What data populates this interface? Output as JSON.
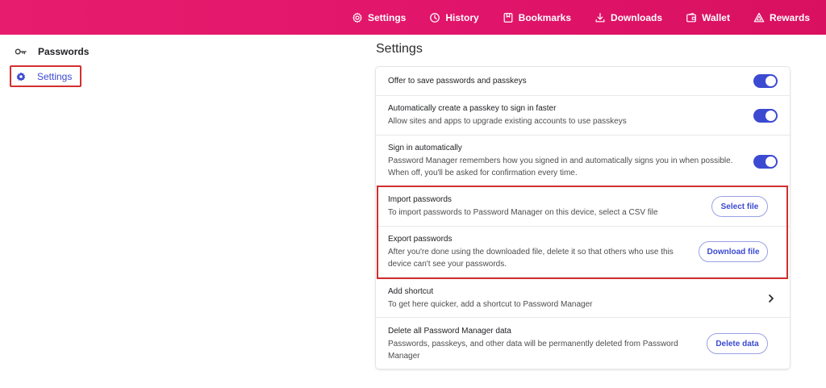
{
  "topnav": {
    "items": [
      {
        "label": "Settings",
        "icon": "gear-icon"
      },
      {
        "label": "History",
        "icon": "history-icon"
      },
      {
        "label": "Bookmarks",
        "icon": "bookmark-icon"
      },
      {
        "label": "Downloads",
        "icon": "download-icon"
      },
      {
        "label": "Wallet",
        "icon": "wallet-icon"
      },
      {
        "label": "Rewards",
        "icon": "rewards-triangle-icon"
      }
    ]
  },
  "sidebar": {
    "items": [
      {
        "label": "Passwords",
        "icon": "key-icon"
      },
      {
        "label": "Settings",
        "icon": "gear-icon",
        "selected": true
      }
    ]
  },
  "main": {
    "title": "Settings",
    "rows": [
      {
        "title": "Offer to save passwords and passkeys",
        "control": "toggle",
        "on": true
      },
      {
        "title": "Automatically create a passkey to sign in faster",
        "desc": "Allow sites and apps to upgrade existing accounts to use passkeys",
        "control": "toggle",
        "on": true
      },
      {
        "title": "Sign in automatically",
        "desc1": "Password Manager remembers how you signed in and automatically signs you in when possible.",
        "desc2": "When off, you'll be asked for confirmation every time.",
        "control": "toggle",
        "on": true
      },
      {
        "title": "Import passwords",
        "desc": "To import passwords to Password Manager on this device, select a CSV file",
        "button": "Select file"
      },
      {
        "title": "Export passwords",
        "desc1": "After you're done using the downloaded file, delete it so that others who use this",
        "desc2": "device can't see your passwords.",
        "button": "Download file"
      },
      {
        "title": "Add shortcut",
        "desc": "To get here quicker, add a shortcut to Password Manager",
        "control": "chevron-right-icon"
      },
      {
        "title": "Delete all Password Manager data",
        "desc1": "Passwords, passkeys, and other data will be permanently deleted from Password",
        "desc2": "Manager",
        "button": "Delete data"
      }
    ]
  },
  "colors": {
    "topbar": "#e81c6e",
    "accent": "#3c4ad1",
    "highlight": "#d32f2f"
  }
}
